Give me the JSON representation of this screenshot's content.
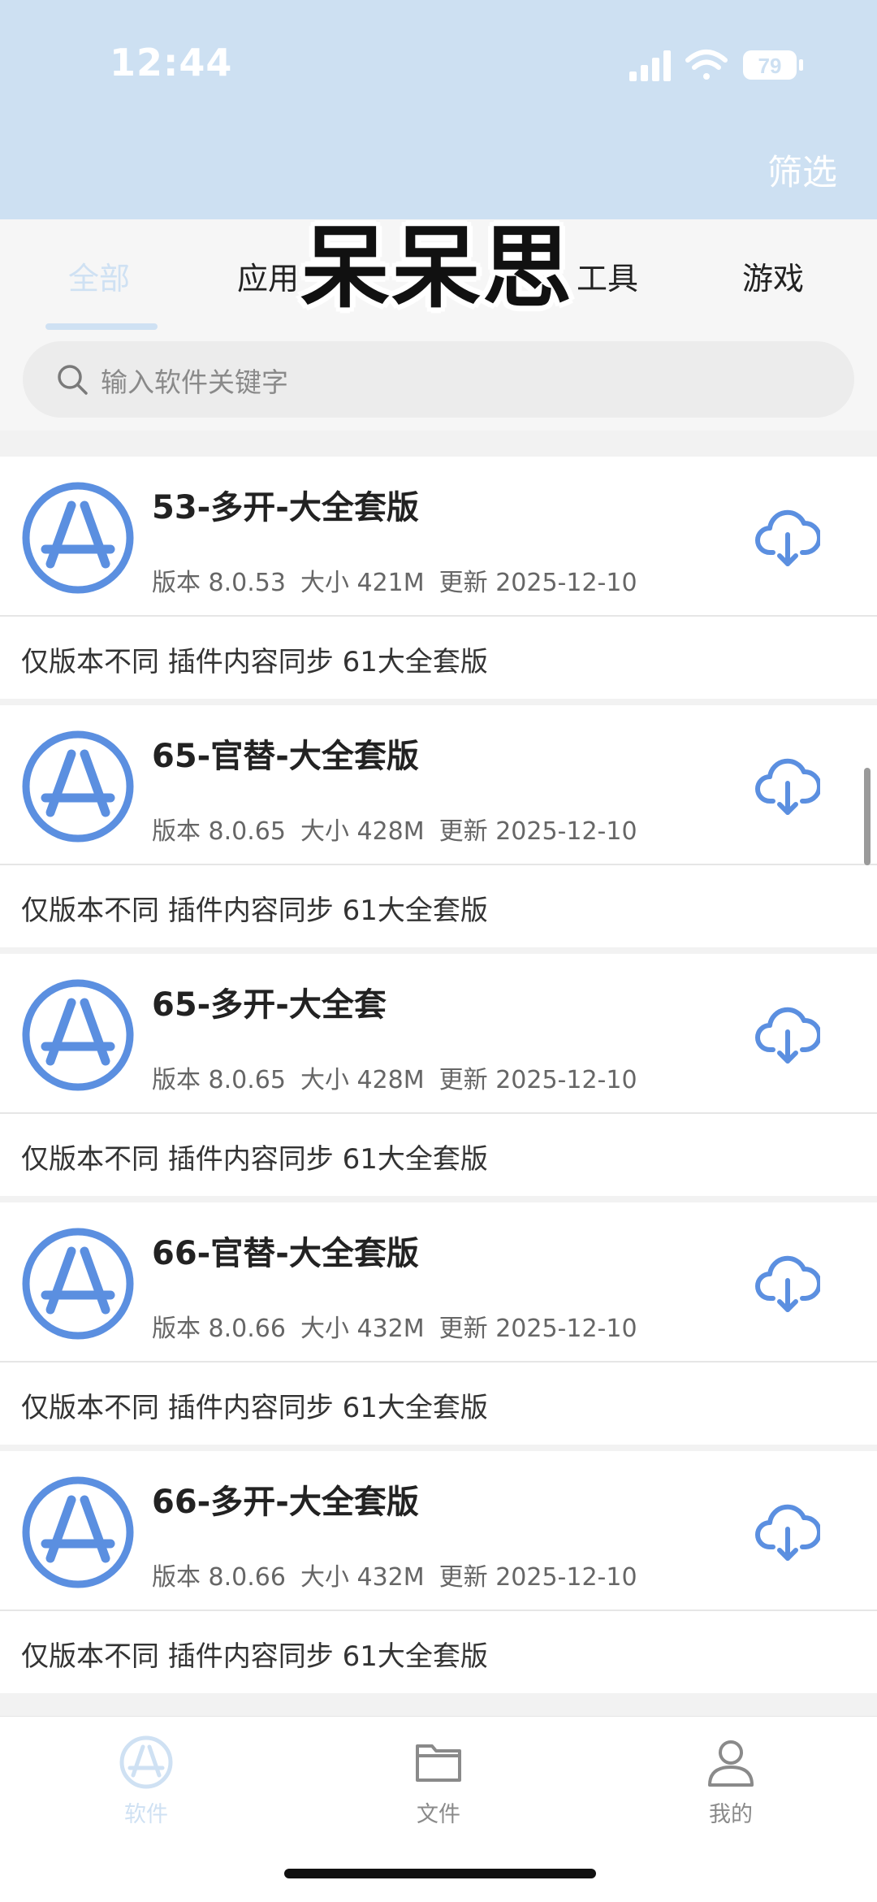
{
  "status_bar": {
    "time": "12:44",
    "battery": "79"
  },
  "header": {
    "filter_label": "筛选"
  },
  "watermark": "呆呆思",
  "tabs": [
    {
      "label": "全部",
      "active": true
    },
    {
      "label": "应用",
      "active": false
    },
    {
      "label": "工具",
      "active": false
    },
    {
      "label": "游戏",
      "active": false
    }
  ],
  "search": {
    "placeholder": "输入软件关键字"
  },
  "items": [
    {
      "title": "53-多开-大全套版",
      "version": "版本 8.0.53",
      "size": "大小 421M",
      "updated": "更新 2025-12-10",
      "description": "仅版本不同 插件内容同步 61大全套版"
    },
    {
      "title": "65-官替-大全套版",
      "version": "版本 8.0.65",
      "size": "大小 428M",
      "updated": "更新 2025-12-10",
      "description": "仅版本不同 插件内容同步 61大全套版"
    },
    {
      "title": "65-多开-大全套",
      "version": "版本 8.0.65",
      "size": "大小 428M",
      "updated": "更新 2025-12-10",
      "description": "仅版本不同 插件内容同步 61大全套版"
    },
    {
      "title": "66-官替-大全套版",
      "version": "版本 8.0.66",
      "size": "大小 432M",
      "updated": "更新 2025-12-10",
      "description": "仅版本不同 插件内容同步 61大全套版"
    },
    {
      "title": "66-多开-大全套版",
      "version": "版本 8.0.66",
      "size": "大小 432M",
      "updated": "更新 2025-12-10",
      "description": "仅版本不同 插件内容同步 61大全套版"
    }
  ],
  "bottom_nav": [
    {
      "label": "软件",
      "icon": "app-store-icon",
      "active": true
    },
    {
      "label": "文件",
      "icon": "folder-icon",
      "active": false
    },
    {
      "label": "我的",
      "icon": "user-icon",
      "active": false
    }
  ],
  "colors": {
    "header_bg": "#cde0f2",
    "accent": "#5b8fe0",
    "active_tab": "#cfe1f3"
  }
}
